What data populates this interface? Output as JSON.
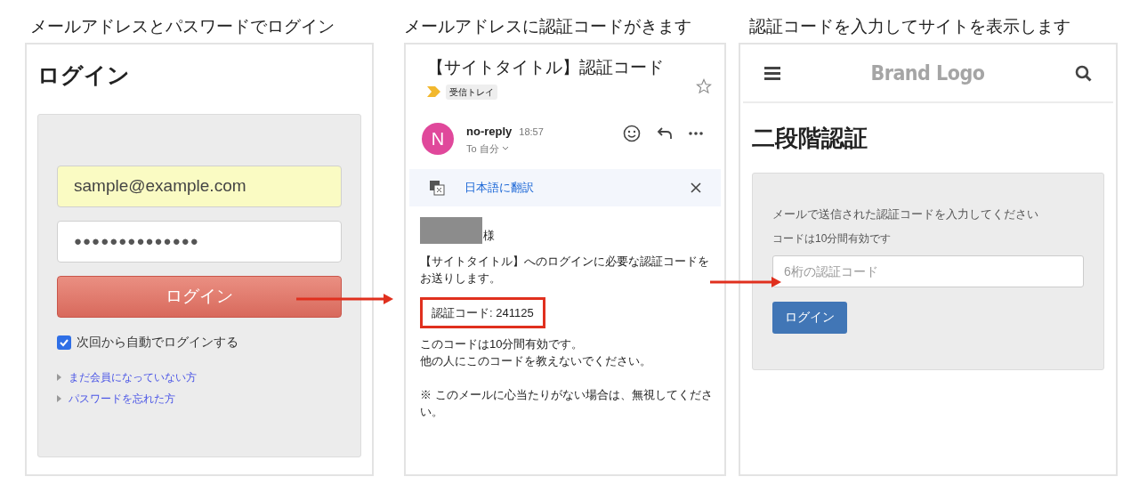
{
  "captions": [
    "メールアドレスとパスワードでログイン",
    "メールアドレスに認証コードがきます",
    "認証コードを入力してサイトを表示します"
  ],
  "login_screen": {
    "title": "ログイン",
    "email": "sample@example.com",
    "password": "●●●●●●●●●●●●●●",
    "button": "ログイン",
    "remember": {
      "label": "次回から自動でログインする",
      "checked": true
    },
    "links": [
      "まだ会員になっていない方",
      "パスワードを忘れた方"
    ]
  },
  "email_screen": {
    "subject": "【サイトタイトル】認証コード",
    "label_tag": "受信トレイ",
    "avatar_letter": "N",
    "sender": "no-reply",
    "time": "18:57",
    "recipient": "To 自分",
    "translate": "日本語に翻訳",
    "greeting_suffix": "様",
    "intro": "【サイトタイトル】へのログインに必要な認証コードをお送りします。",
    "code_line": "認証コード: 241125",
    "notes": [
      "このコードは10分間有効です。",
      "他の人にこのコードを教えないでください。"
    ],
    "disclaimer": "※ このメールに心当たりがない場合は、無視してください。"
  },
  "verify_screen": {
    "logo": "Brand Logo",
    "title": "二段階認証",
    "instruction": "メールで送信された認証コードを入力してください",
    "hint": "コードは10分間有効です",
    "placeholder": "6桁の認証コード",
    "button": "ログイン"
  }
}
